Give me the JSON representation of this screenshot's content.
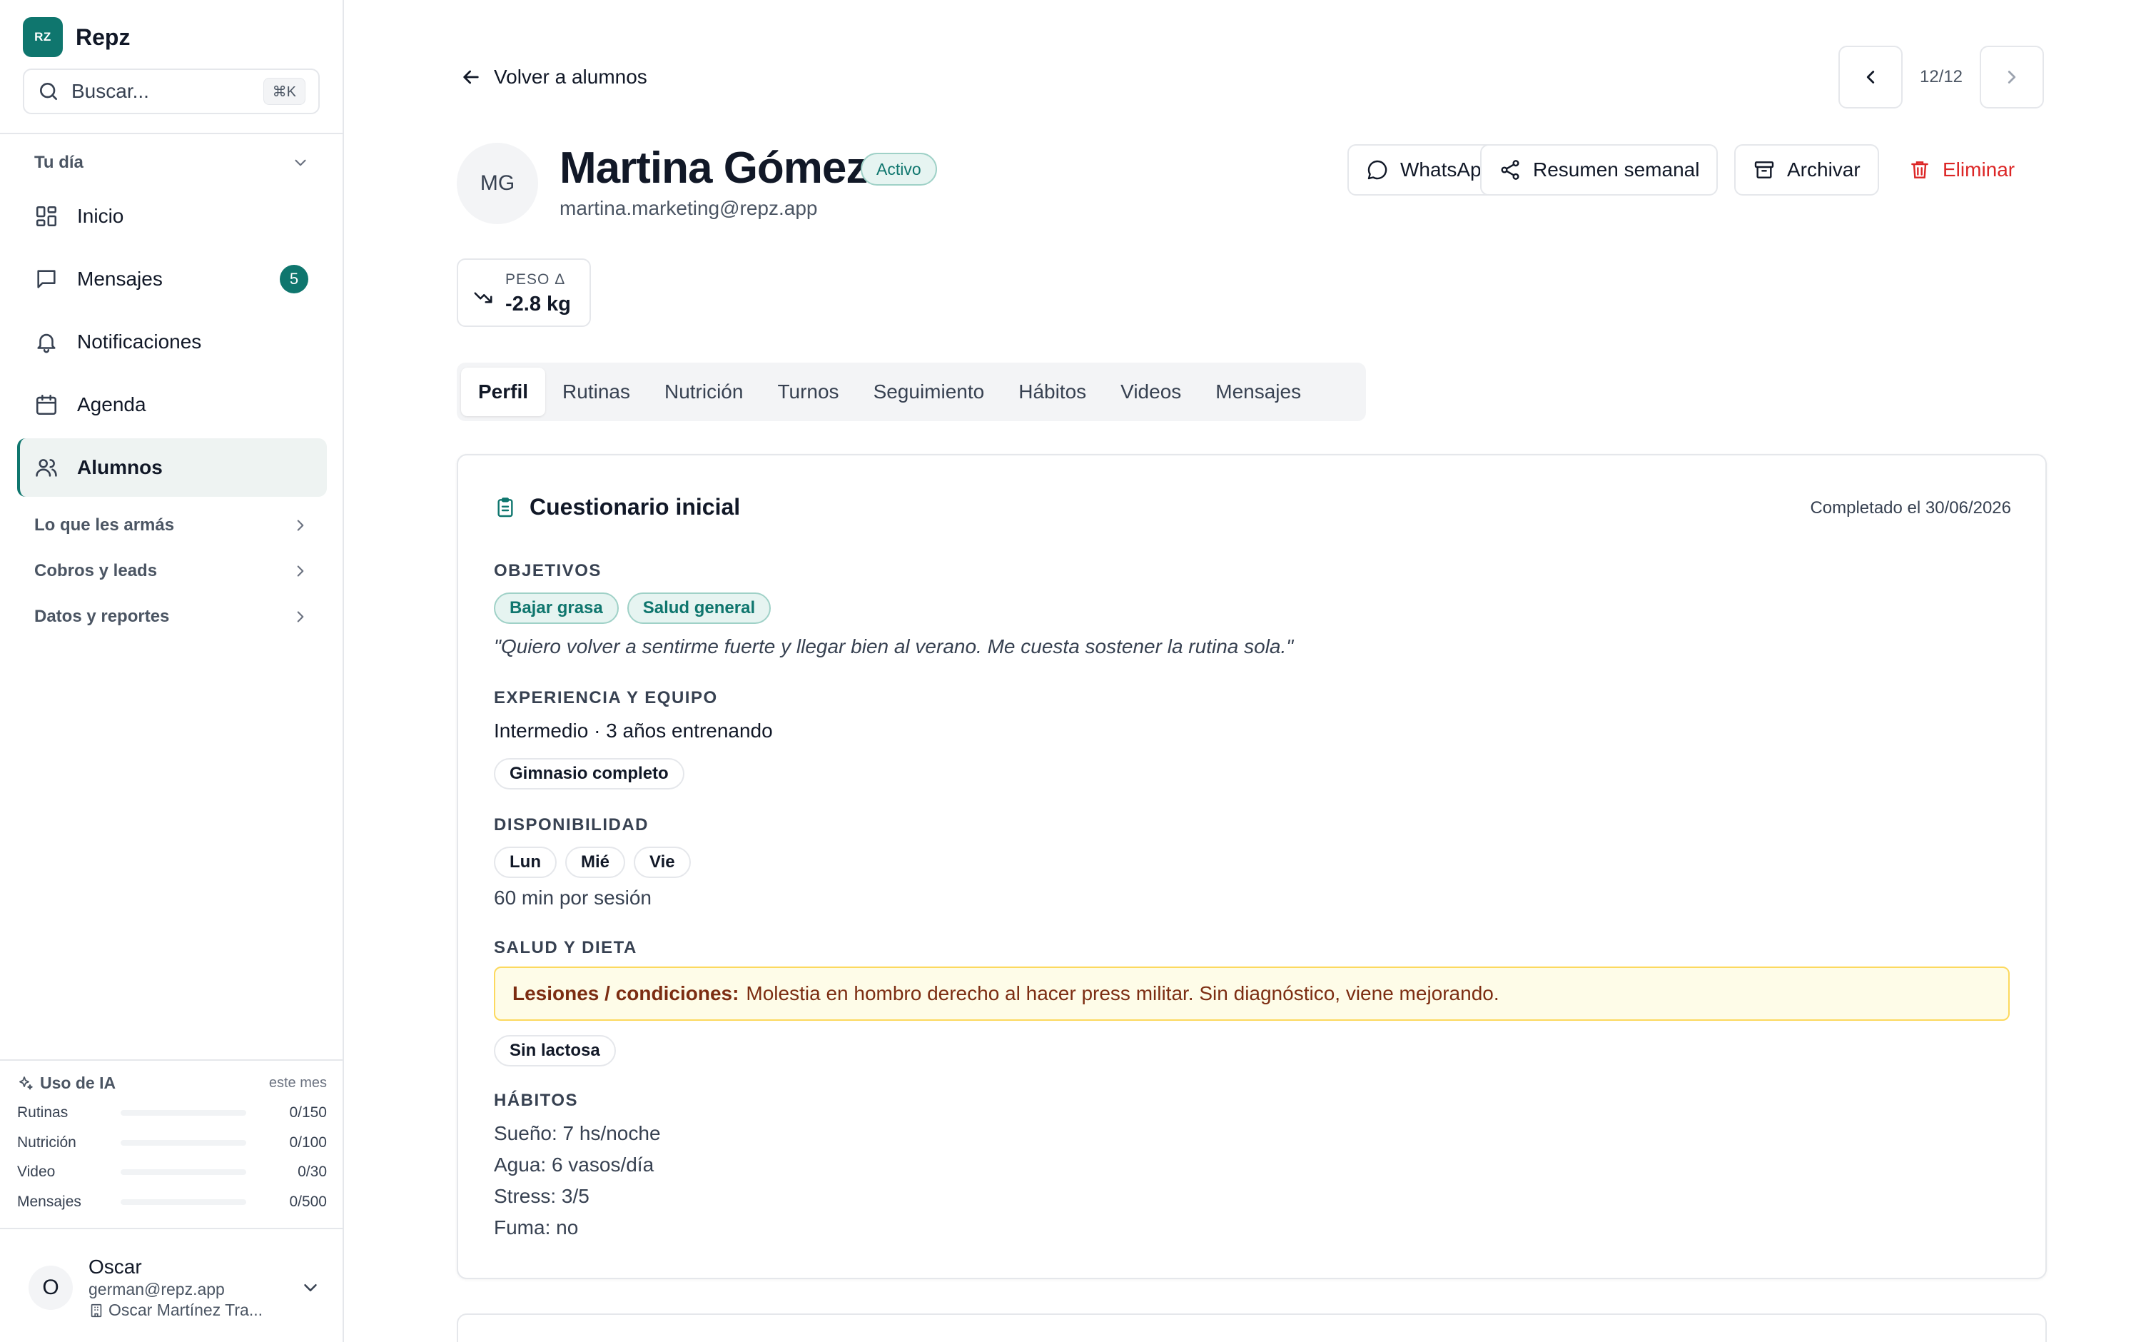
{
  "brand": {
    "logo_text": "RZ",
    "name": "Repz",
    "accent": "#0f766e"
  },
  "search": {
    "placeholder": "Buscar...",
    "shortcut": "⌘K"
  },
  "sidebar": {
    "group_day": "Tu día",
    "items": [
      {
        "label": "Inicio",
        "icon": "grid-icon"
      },
      {
        "label": "Mensajes",
        "icon": "chat-icon",
        "badge": "5"
      },
      {
        "label": "Notificaciones",
        "icon": "bell-icon"
      },
      {
        "label": "Agenda",
        "icon": "calendar-icon"
      },
      {
        "label": "Alumnos",
        "icon": "users-icon",
        "active": true
      }
    ],
    "groups": [
      "Lo que les armás",
      "Cobros y leads",
      "Datos y reportes"
    ]
  },
  "usage": {
    "title": "Uso de IA",
    "period": "este mes",
    "rows": [
      {
        "label": "Rutinas",
        "value": "0/150",
        "fraction": 0
      },
      {
        "label": "Nutrición",
        "value": "0/100",
        "fraction": 0
      },
      {
        "label": "Video",
        "value": "0/30",
        "fraction": 0
      },
      {
        "label": "Mensajes",
        "value": "0/500",
        "fraction": 0
      }
    ]
  },
  "user": {
    "initial": "O",
    "name": "Oscar",
    "email": "german@repz.app",
    "org": "Oscar Martínez Tra..."
  },
  "header": {
    "back_label": "Volver a alumnos",
    "pager": "12/12"
  },
  "student": {
    "initials": "MG",
    "name": "Martina Gómez",
    "status": "Activo",
    "email": "martina.marketing@repz.app"
  },
  "actions": {
    "whatsapp": "WhatsApp",
    "summary": "Resumen semanal",
    "archive": "Archivar",
    "delete": "Eliminar"
  },
  "metric": {
    "label": "PESO Δ",
    "value": "-2.8 kg"
  },
  "tabs": [
    "Perfil",
    "Rutinas",
    "Nutrición",
    "Turnos",
    "Seguimiento",
    "Hábitos",
    "Videos",
    "Mensajes"
  ],
  "questionnaire": {
    "title": "Cuestionario inicial",
    "completed": "Completado el 30/06/2026",
    "objectives_label": "OBJETIVOS",
    "objectives": [
      "Bajar grasa",
      "Salud general"
    ],
    "quote": "\"Quiero volver a sentirme fuerte y llegar bien al verano. Me cuesta sostener la rutina sola.\"",
    "experience_label": "EXPERIENCIA Y EQUIPO",
    "experience": "Intermedio · 3 años entrenando",
    "equipment": [
      "Gimnasio completo"
    ],
    "availability_label": "DISPONIBILIDAD",
    "days": [
      "Lun",
      "Mié",
      "Vie"
    ],
    "session": "60 min por sesión",
    "health_label": "SALUD Y DIETA",
    "injuries_label": "Lesiones / condiciones:",
    "injuries": "Molestia en hombro derecho al hacer press militar. Sin diagnóstico, viene mejorando.",
    "diet": [
      "Sin lactosa"
    ],
    "habits_label": "HÁBITOS",
    "habits": [
      "Sueño: 7 hs/noche",
      "Agua: 6 vasos/día",
      "Stress: 3/5",
      "Fuma: no"
    ]
  }
}
